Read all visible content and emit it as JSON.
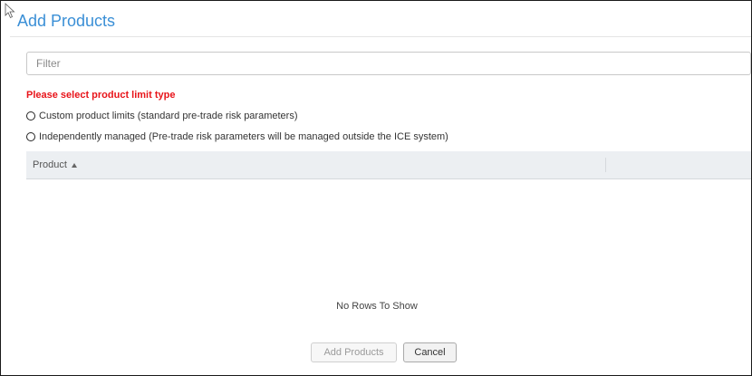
{
  "dialog": {
    "title": "Add Products"
  },
  "filter": {
    "placeholder": "Filter",
    "value": ""
  },
  "limit_type": {
    "prompt": "Please select product limit type",
    "options": [
      {
        "label": "Custom product limits (standard pre-trade risk parameters)",
        "selected": false
      },
      {
        "label": "Independently managed (Pre-trade risk parameters will be managed outside the ICE system)",
        "selected": false
      }
    ]
  },
  "grid": {
    "columns": [
      {
        "label": "Product",
        "sort": "ascending",
        "sort_icon": "sort-ascending-icon"
      }
    ],
    "empty_message": "No Rows To Show"
  },
  "actions": {
    "add_label": "Add Products",
    "add_disabled": true,
    "cancel_label": "Cancel"
  },
  "colors": {
    "title": "#3a8fd6",
    "prompt": "#e8141a",
    "header_bg": "#eceff2"
  }
}
